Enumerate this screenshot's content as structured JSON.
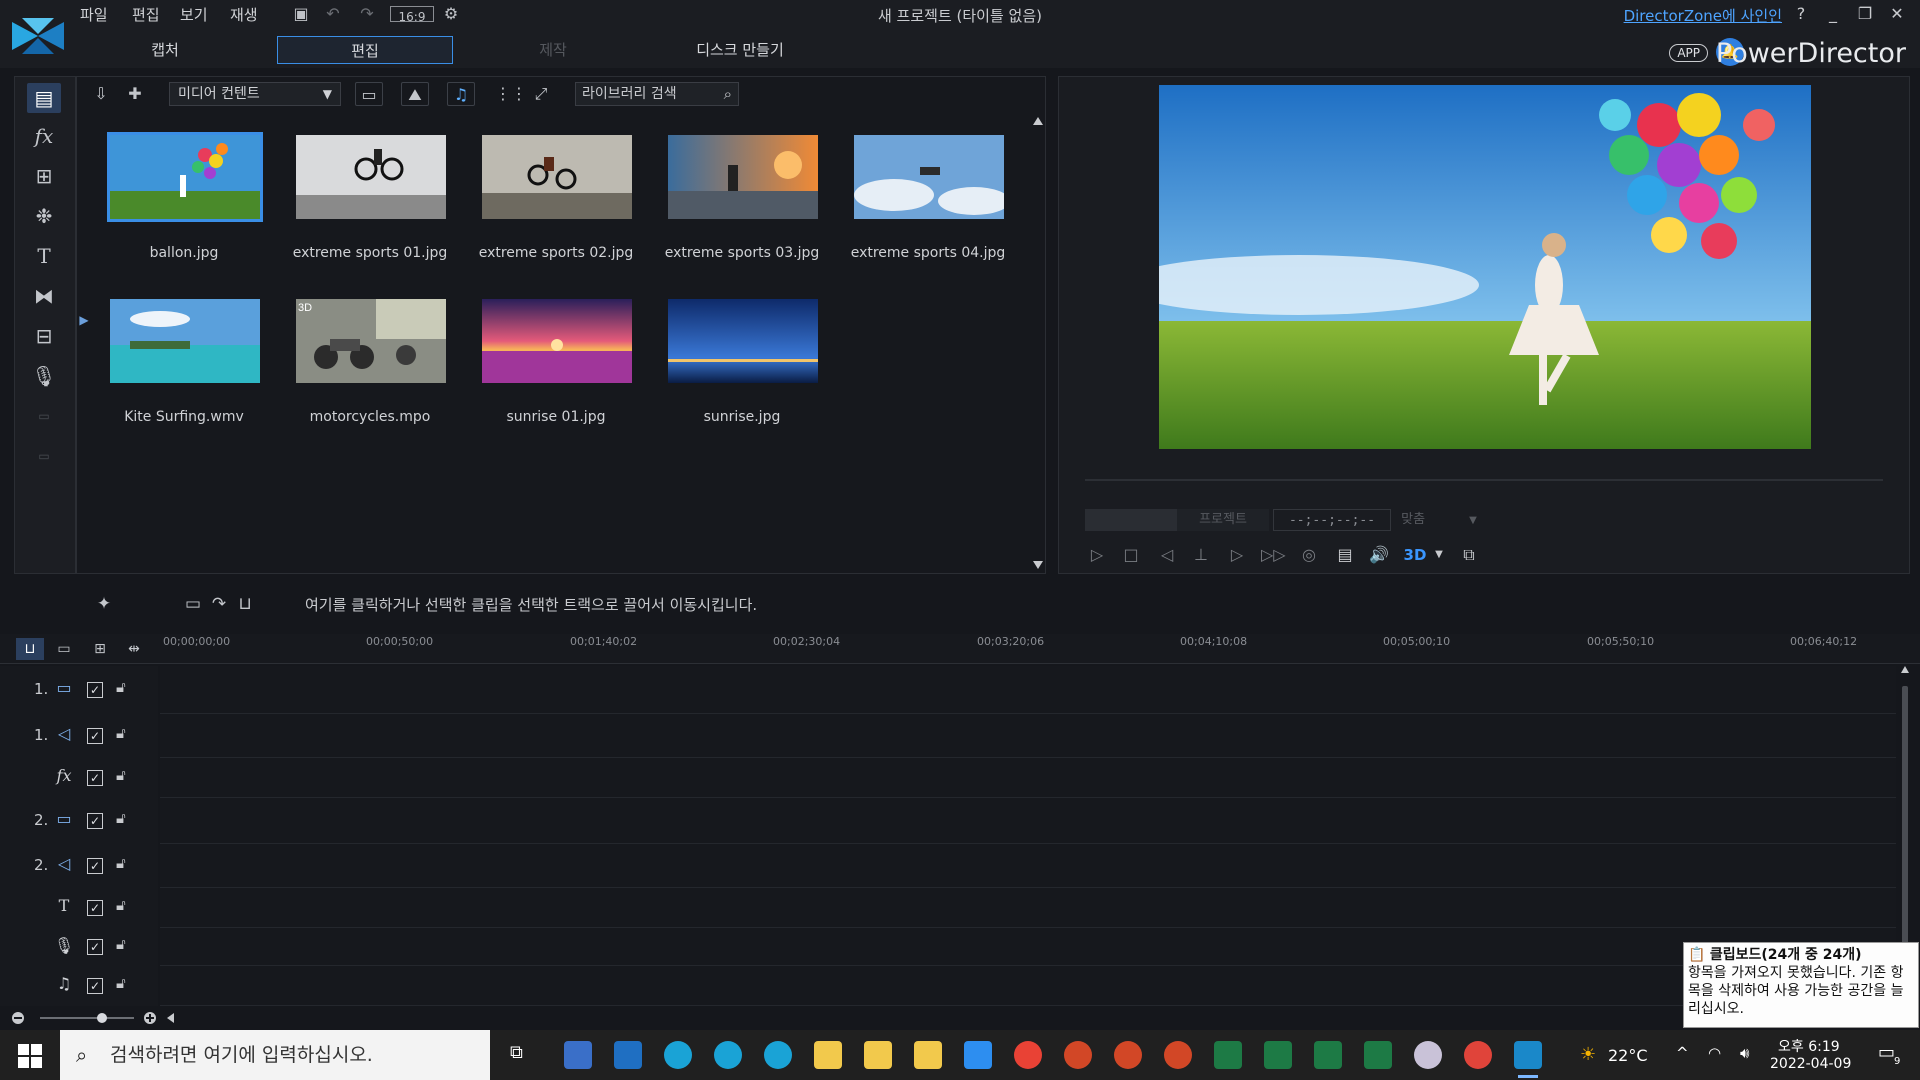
{
  "menu": {
    "items": [
      "파일",
      "편집",
      "보기",
      "재생"
    ],
    "aspect": "16:9",
    "window_title": "새 프로젝트 (타이틀 없음)",
    "signin_link": "DirectorZone에 사인인"
  },
  "tabs": [
    {
      "label": "캡처",
      "state": "normal"
    },
    {
      "label": "편집",
      "state": "active"
    },
    {
      "label": "제작",
      "state": "disabled"
    },
    {
      "label": "디스크 만들기",
      "state": "normal"
    }
  ],
  "brand": {
    "app_badge": "APP",
    "name": "PowerDirector"
  },
  "library": {
    "media_select": "미디어 컨텐트",
    "search_placeholder": "라이브러리 검색",
    "items": [
      {
        "label": "ballon.jpg",
        "selected": true,
        "badge": ""
      },
      {
        "label": "extreme sports 01.jpg",
        "selected": false,
        "badge": ""
      },
      {
        "label": "extreme sports 02.jpg",
        "selected": false,
        "badge": ""
      },
      {
        "label": "extreme sports 03.jpg",
        "selected": false,
        "badge": ""
      },
      {
        "label": "extreme sports 04.jpg",
        "selected": false,
        "badge": ""
      },
      {
        "label": "Kite Surfing.wmv",
        "selected": false,
        "badge": ""
      },
      {
        "label": "motorcycles.mpo",
        "selected": false,
        "badge": "3D"
      },
      {
        "label": "sunrise 01.jpg",
        "selected": false,
        "badge": ""
      },
      {
        "label": "sunrise.jpg",
        "selected": false,
        "badge": ""
      }
    ]
  },
  "preview": {
    "mode_label": "프로젝트",
    "timecode": "--;--;--;--",
    "fit_label": "맞춤",
    "three_d": "3D"
  },
  "timeline": {
    "hint": "여기를 클릭하거나 선택한 클립을 선택한 트랙으로 끌어서 이동시킵니다.",
    "ruler": [
      "00;00;00;00",
      "00;00;50;00",
      "00;01;40;02",
      "00;02;30;04",
      "00;03;20;06",
      "00;04;10;08",
      "00;05;00;10",
      "00;05;50;10",
      "00;06;40;12"
    ],
    "tracks": [
      {
        "num": "1.",
        "icon": "video-track-icon",
        "glyph": "▭"
      },
      {
        "num": "1.",
        "icon": "audio-track-icon",
        "glyph": "◁"
      },
      {
        "num": "",
        "icon": "fx-track-icon",
        "glyph": "fx"
      },
      {
        "num": "2.",
        "icon": "video-track-icon",
        "glyph": "▭"
      },
      {
        "num": "2.",
        "icon": "audio-track-icon",
        "glyph": "◁"
      },
      {
        "num": "",
        "icon": "title-track-icon",
        "glyph": "T"
      },
      {
        "num": "",
        "icon": "voice-track-icon",
        "glyph": "🎙"
      },
      {
        "num": "",
        "icon": "music-track-icon",
        "glyph": "♫"
      }
    ]
  },
  "clipboard_toast": {
    "title": "클립보드(24개 중 24개)",
    "body": "항목을 가져오지 못했습니다. 기존 항목을 삭제하여 사용 가능한 공간을 늘리십시오."
  },
  "taskbar": {
    "search_placeholder": "검색하려면 여기에 입력하십시오.",
    "temperature": "22°C",
    "time": "오후 6:19",
    "date": "2022-04-09",
    "notif_count": "9"
  },
  "colors": {
    "accent": "#3a8ee6",
    "link": "#4ea4ff",
    "bg": "#15171c"
  }
}
